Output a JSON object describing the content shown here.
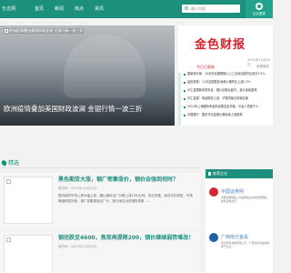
{
  "header": {
    "logo_text": "仓息网",
    "nav": [
      "首页",
      "新闻",
      "热点",
      "资讯"
    ],
    "search_placeholder": "输入内容",
    "login_label": "企业登录"
  },
  "banner": {
    "alt_text": "欧洲疫情叠加美国财政波澜 金银行情一波三折",
    "title": "欧洲疫情叠加美国财政波澜 金银行情一波三折"
  },
  "side": {
    "brand": "金色财报",
    "date": "2021年11月05日",
    "today_label": "今日已更新",
    "more_label": "查看更多",
    "items": [
      "国家统计局：10月份全国规模以上工业增加值同比增长3.5%",
      "金色财报：11月全国居民消费价格同比上涨2.3%",
      "中汇金银新闻发布会：银价站稳后回升，金价延续震荡",
      "中汇金银：商品期货上涨，沪银突破日内新高度",
      "2021年上海国际黄金精品展览会开幕，与会人员超千人",
      "中国银行：国庆节后金银价格延续上涨趋势"
    ]
  },
  "section": {
    "title": "精选"
  },
  "articles": [
    {
      "title": "黑色期货大涨，钢厂密集涨价，钢价会强到何时？",
      "meta": "有的网 · 2021年11月23日",
      "summary": "国内钢材市场上周大幅上涨，唐山钢坯出厂价格上涨100元/吨，成交改善，库存去化明显，市场情绪明显好转，钢厂密集调涨出厂价，部分地区出现惜售现象……"
    },
    {
      "title": "钢坯跌至4600，焦炭再提降200，钢价继续弱势难改！",
      "meta": "有的网 · 2021年11月22日",
      "summary": ""
    }
  ],
  "ads": {
    "header": "推荐企业",
    "blocks": [
      {
        "title": "中国证券网",
        "desc": "中国证券网是上海证券报主办的财经网站，提供证券资讯"
      },
      {
        "title": "广西南方金属",
        "desc": "南方有色金属有限公司，广西有色金属冶炼骨干企业"
      }
    ]
  },
  "colors": {
    "brand": "#1c8f7d",
    "accent_red": "#d6262e",
    "link_blue": "#4f84c4"
  }
}
